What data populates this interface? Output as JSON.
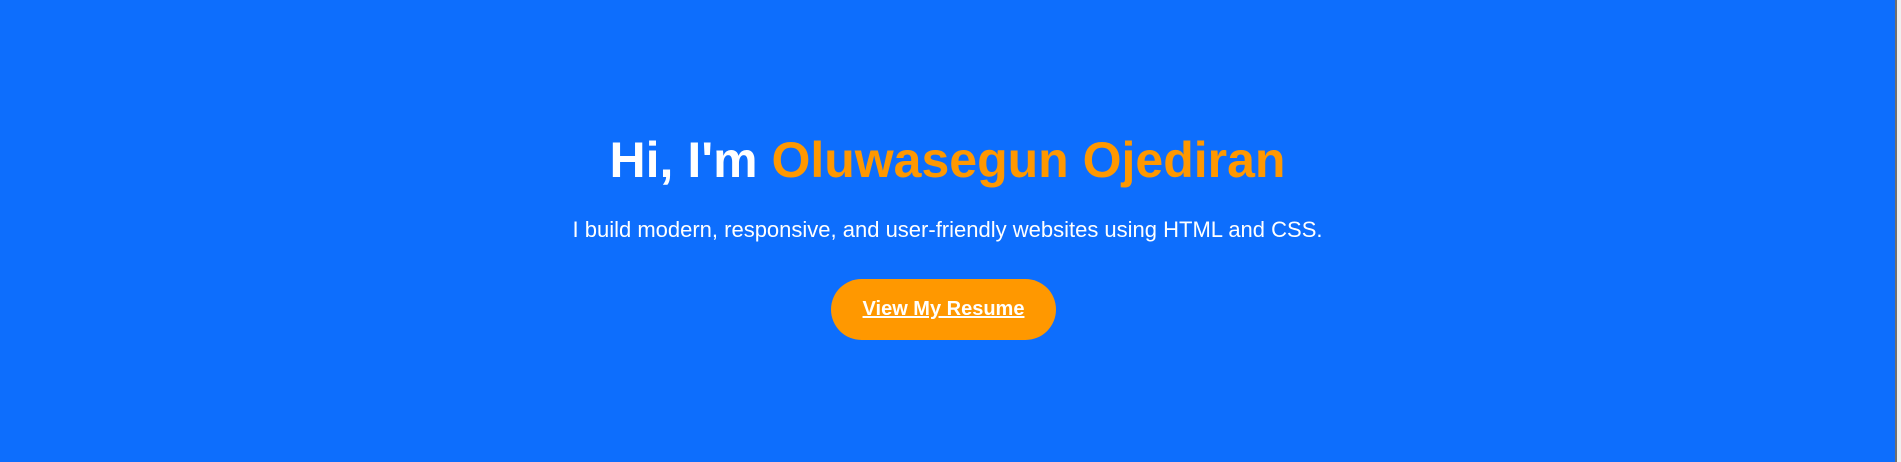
{
  "hero": {
    "title_prefix": "Hi, I'm ",
    "title_name": "Oluwasegun Ojediran",
    "subtitle": "I build modern, responsive, and user-friendly websites using HTML and CSS.",
    "cta_label": "View My Resume"
  },
  "colors": {
    "background": "#0d6efd",
    "accent": "#ff9800",
    "text": "#ffffff"
  }
}
